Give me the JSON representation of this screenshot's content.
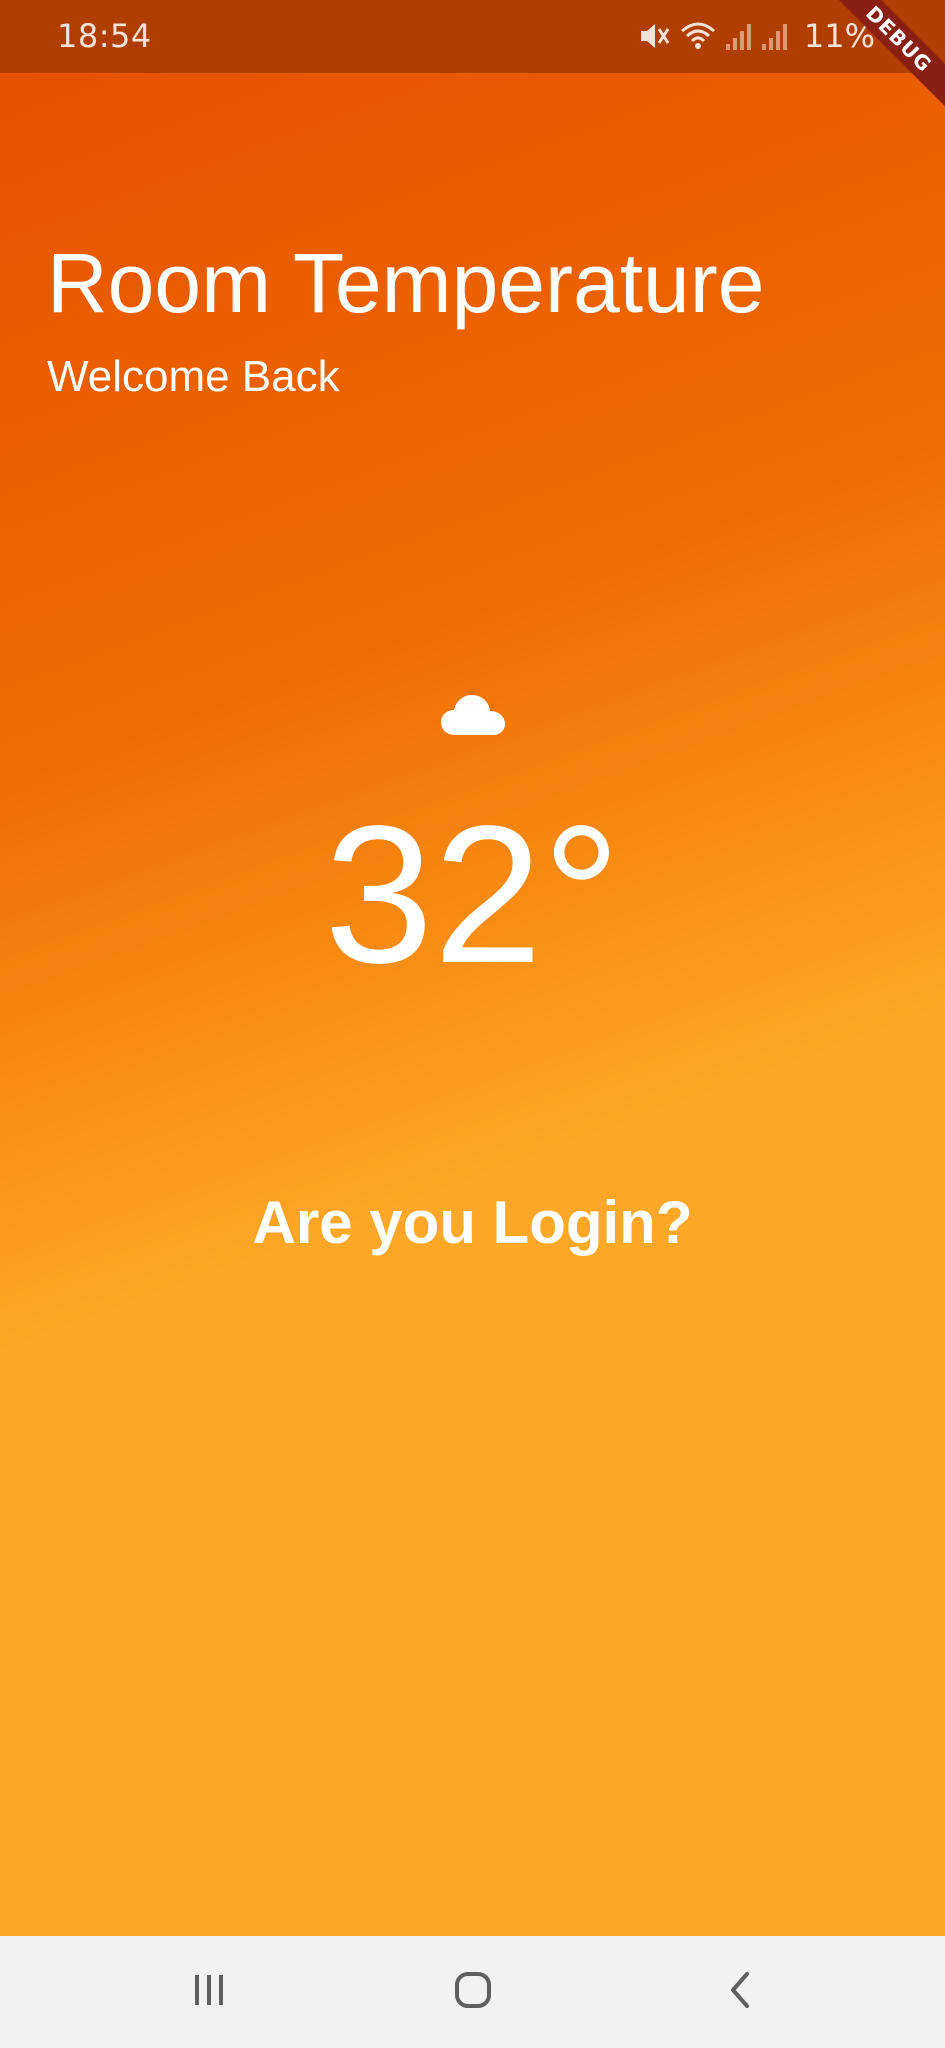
{
  "status_bar": {
    "time": "18:54",
    "battery": "11%",
    "icons": [
      "mute-icon",
      "wifi-icon",
      "signal-icon",
      "signal-icon",
      "battery-icon"
    ],
    "color": "#b03e00"
  },
  "debug_banner": {
    "label": "DEBUG",
    "color": "#8a1f14"
  },
  "app": {
    "title": "Room Temperature",
    "subtitle": "Welcome Back",
    "weather_icon": "cloud-icon",
    "temperature": "32°",
    "login_prompt": "Are you Login?",
    "gradient": [
      "#e65100",
      "#ef6c00",
      "#ffa726"
    ]
  },
  "nav_bar": {
    "buttons": [
      "recent-apps-icon",
      "home-icon",
      "back-icon"
    ]
  }
}
